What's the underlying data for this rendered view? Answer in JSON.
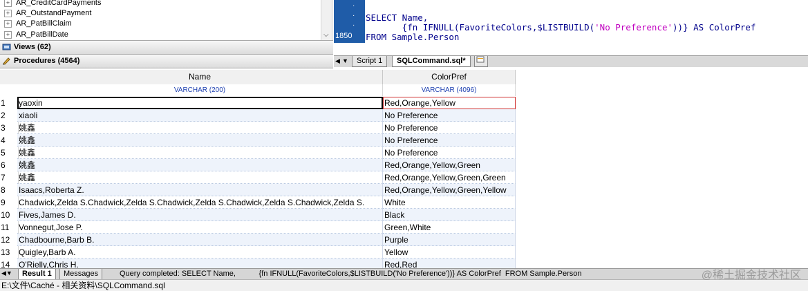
{
  "tree": {
    "items": [
      {
        "label": "AR_CreditCardPayments"
      },
      {
        "label": "AR_OutstandPayment"
      },
      {
        "label": "AR_PatBillClaim"
      },
      {
        "label": "AR_PatBillDate"
      }
    ]
  },
  "views_bar": {
    "label": "Views (62)"
  },
  "procedures_bar": {
    "label": "Procedures (4564)"
  },
  "editor": {
    "line_number": "1850",
    "line1": "SELECT Name,",
    "line2_pre": "       {fn IFNULL(FavoriteColors,$LISTBUILD(",
    "line2_str": "'No Preference'",
    "line2_post": "))} AS ColorPref",
    "line3": "FROM Sample.Person"
  },
  "tabs": {
    "script": "Script 1",
    "sqlcommand": "SQLCommand.sql*"
  },
  "grid": {
    "columns": [
      {
        "name": "Name",
        "type": "VARCHAR (200)"
      },
      {
        "name": "ColorPref",
        "type": "VARCHAR (4096)"
      }
    ],
    "rows": [
      {
        "num": "1",
        "name": "yaoxin",
        "pref": "Red,Orange,Yellow"
      },
      {
        "num": "2",
        "name": "xiaoli",
        "pref": "No Preference"
      },
      {
        "num": "3",
        "name": "姚鑫",
        "pref": "No Preference"
      },
      {
        "num": "4",
        "name": "姚鑫",
        "pref": "No Preference"
      },
      {
        "num": "5",
        "name": "姚鑫",
        "pref": "No Preference"
      },
      {
        "num": "6",
        "name": "姚鑫",
        "pref": "Red,Orange,Yellow,Green"
      },
      {
        "num": "7",
        "name": "姚鑫",
        "pref": "Red,Orange,Yellow,Green,Green"
      },
      {
        "num": "8",
        "name": "Isaacs,Roberta Z.",
        "pref": "Red,Orange,Yellow,Green,Yellow"
      },
      {
        "num": "9",
        "name": "Chadwick,Zelda S.Chadwick,Zelda S.Chadwick,Zelda S.Chadwick,Zelda S.Chadwick,Zelda S.",
        "pref": "White"
      },
      {
        "num": "10",
        "name": "Fives,James D.",
        "pref": "Black"
      },
      {
        "num": "11",
        "name": "Vonnegut,Jose P.",
        "pref": "Green,White"
      },
      {
        "num": "12",
        "name": "Chadbourne,Barb B.",
        "pref": "Purple"
      },
      {
        "num": "13",
        "name": "Quigley,Barb A.",
        "pref": "Yellow"
      },
      {
        "num": "14",
        "name": "O'Rielly,Chris H.",
        "pref": "Red,Red"
      }
    ]
  },
  "result_bar": {
    "result_tab": "Result 1",
    "messages_tab": "Messages",
    "status_text": "Query completed: SELECT Name,           {fn IFNULL(FavoriteColors,$LISTBUILD('No Preference'))} AS ColorPref  FROM Sample.Person"
  },
  "status_bar": {
    "path": "E:\\文件\\Caché - 相关资料\\SQLCommand.sql"
  },
  "watermark": "@稀土掘金技术社区",
  "colors": {
    "gutter": "#1f5ca8",
    "type_text": "#1c3fb0",
    "string": "#c000c0",
    "selection_red": "#d03030"
  }
}
